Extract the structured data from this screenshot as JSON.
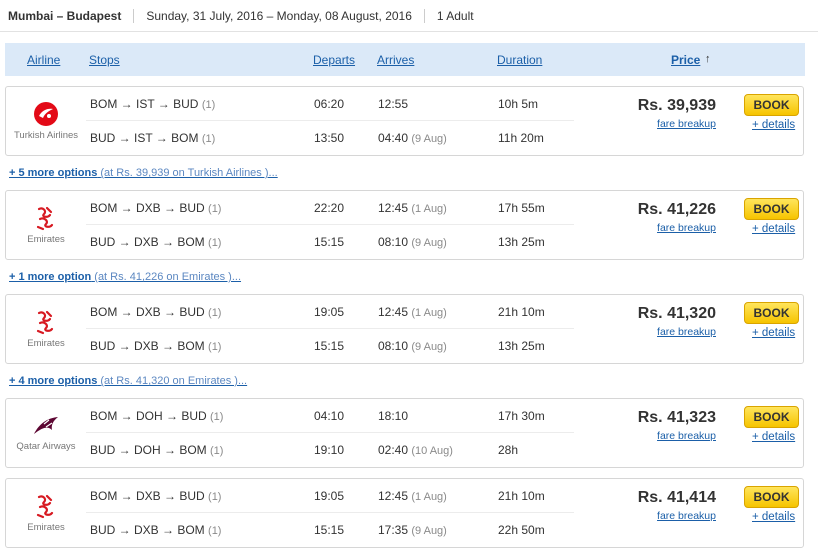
{
  "search": {
    "route": "Mumbai – Budapest",
    "dates": "Sunday, 31 July, 2016 – Monday, 08 August, 2016",
    "passengers": "1 Adult"
  },
  "columns": {
    "airline": "Airline",
    "stops": "Stops",
    "departs": "Departs",
    "arrives": "Arrives",
    "duration": "Duration",
    "price": "Price",
    "price_sort_arrow": "↑"
  },
  "colors": {
    "header_bg": "#dbe9f8",
    "link": "#1b5fa8",
    "book_button": "#f6c400",
    "turkish_red": "#e30a17",
    "emirates_red": "#d71921",
    "qatar_maroon": "#5c0632"
  },
  "results": [
    {
      "airline": "Turkish Airlines",
      "logo_icon": "turkish-airlines-icon",
      "price": "Rs. 39,939",
      "fare_breakup": "fare breakup",
      "book": "BOOK",
      "details": "+ details",
      "legs": [
        {
          "route": "BOM → IST → BUD",
          "stops": "(1)",
          "departs": "06:20",
          "arrives": "12:55",
          "arrives_note": "",
          "duration": "10h 5m"
        },
        {
          "route": "BUD → IST → BOM",
          "stops": "(1)",
          "departs": "13:50",
          "arrives": "04:40",
          "arrives_note": "(9 Aug)",
          "duration": "11h 20m"
        }
      ],
      "more": {
        "count": "+ 5 more options",
        "rest": "(at Rs. 39,939 on Turkish Airlines )..."
      }
    },
    {
      "airline": "Emirates",
      "logo_icon": "emirates-icon",
      "price": "Rs. 41,226",
      "fare_breakup": "fare breakup",
      "book": "BOOK",
      "details": "+ details",
      "legs": [
        {
          "route": "BOM → DXB → BUD",
          "stops": "(1)",
          "departs": "22:20",
          "arrives": "12:45",
          "arrives_note": "(1 Aug)",
          "duration": "17h 55m"
        },
        {
          "route": "BUD → DXB → BOM",
          "stops": "(1)",
          "departs": "15:15",
          "arrives": "08:10",
          "arrives_note": "(9 Aug)",
          "duration": "13h 25m"
        }
      ],
      "more": {
        "count": "+ 1 more option",
        "rest": "(at Rs. 41,226 on Emirates )..."
      }
    },
    {
      "airline": "Emirates",
      "logo_icon": "emirates-icon",
      "price": "Rs. 41,320",
      "fare_breakup": "fare breakup",
      "book": "BOOK",
      "details": "+ details",
      "legs": [
        {
          "route": "BOM → DXB → BUD",
          "stops": "(1)",
          "departs": "19:05",
          "arrives": "12:45",
          "arrives_note": "(1 Aug)",
          "duration": "21h 10m"
        },
        {
          "route": "BUD → DXB → BOM",
          "stops": "(1)",
          "departs": "15:15",
          "arrives": "08:10",
          "arrives_note": "(9 Aug)",
          "duration": "13h 25m"
        }
      ],
      "more": {
        "count": "+ 4 more options",
        "rest": "(at Rs. 41,320 on Emirates )..."
      }
    },
    {
      "airline": "Qatar Airways",
      "logo_icon": "qatar-airways-icon",
      "price": "Rs. 41,323",
      "fare_breakup": "fare breakup",
      "book": "BOOK",
      "details": "+ details",
      "legs": [
        {
          "route": "BOM → DOH → BUD",
          "stops": "(1)",
          "departs": "04:10",
          "arrives": "18:10",
          "arrives_note": "",
          "duration": "17h 30m"
        },
        {
          "route": "BUD → DOH → BOM",
          "stops": "(1)",
          "departs": "19:10",
          "arrives": "02:40",
          "arrives_note": "(10 Aug)",
          "duration": "28h"
        }
      ],
      "more": null
    },
    {
      "airline": "Emirates",
      "logo_icon": "emirates-icon",
      "price": "Rs. 41,414",
      "fare_breakup": "fare breakup",
      "book": "BOOK",
      "details": "+ details",
      "legs": [
        {
          "route": "BOM → DXB → BUD",
          "stops": "(1)",
          "departs": "19:05",
          "arrives": "12:45",
          "arrives_note": "(1 Aug)",
          "duration": "21h 10m"
        },
        {
          "route": "BUD → DXB → BOM",
          "stops": "(1)",
          "departs": "15:15",
          "arrives": "17:35",
          "arrives_note": "(9 Aug)",
          "duration": "22h 50m"
        }
      ],
      "more": null
    }
  ]
}
